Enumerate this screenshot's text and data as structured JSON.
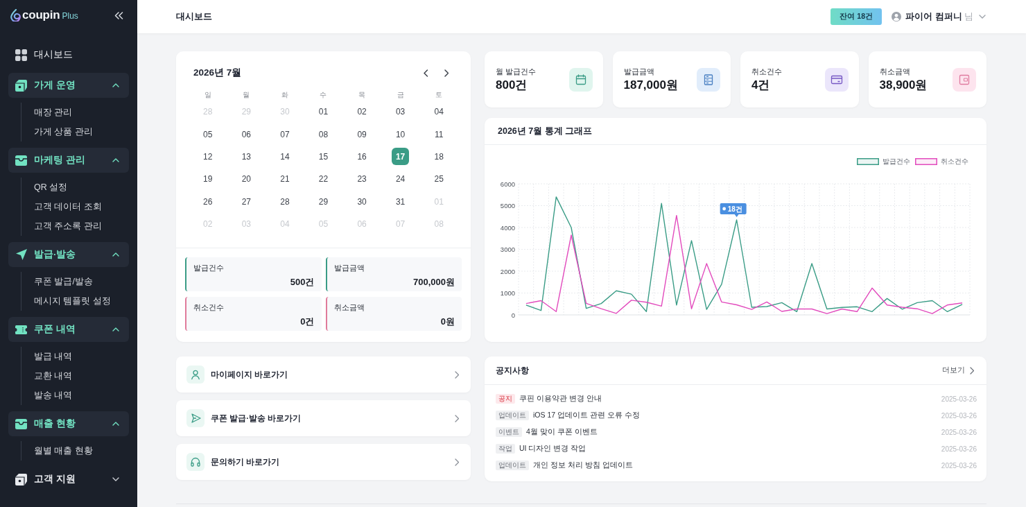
{
  "sidebar": {
    "logo": {
      "name": "coupin",
      "suffix": "Plus"
    },
    "items": [
      {
        "kind": "link",
        "label": "대시보드"
      },
      {
        "kind": "group",
        "label": "가게 운영",
        "expanded": true,
        "children": [
          {
            "label": "매장 관리"
          },
          {
            "label": "가게 상품 관리"
          }
        ]
      },
      {
        "kind": "group",
        "label": "마케팅 관리",
        "expanded": true,
        "children": [
          {
            "label": "QR 설정"
          },
          {
            "label": "고객 데이터 조회"
          },
          {
            "label": "고객 주소록 관리"
          }
        ]
      },
      {
        "kind": "group",
        "label": "발급·발송",
        "expanded": true,
        "children": [
          {
            "label": "쿠폰 발급/발송"
          },
          {
            "label": "메시지 템플릿 설정"
          }
        ]
      },
      {
        "kind": "group",
        "label": "쿠폰 내역",
        "expanded": true,
        "children": [
          {
            "label": "발급 내역"
          },
          {
            "label": "교환 내역"
          },
          {
            "label": "발송 내역"
          }
        ]
      },
      {
        "kind": "group",
        "label": "매출 현황",
        "expanded": true,
        "children": [
          {
            "label": "월별 매출 현황"
          }
        ]
      },
      {
        "kind": "group",
        "label": "고객 지원",
        "expanded": false
      }
    ]
  },
  "header": {
    "title": "대시보드",
    "badge": "잔여 18건",
    "user": {
      "name": "파이어 컴퍼니",
      "suffix": "님"
    }
  },
  "calendar": {
    "title": "2026년 7월",
    "weekdays": [
      "일",
      "월",
      "화",
      "수",
      "목",
      "금",
      "토"
    ],
    "weeks": [
      [
        {
          "day": "28",
          "outside": true,
          "selected": false
        },
        {
          "day": "29",
          "outside": true,
          "selected": false
        },
        {
          "day": "30",
          "outside": true,
          "selected": false
        },
        {
          "day": "01",
          "outside": false,
          "selected": false
        },
        {
          "day": "02",
          "outside": false,
          "selected": false
        },
        {
          "day": "03",
          "outside": false,
          "selected": false
        },
        {
          "day": "04",
          "outside": false,
          "selected": false
        }
      ],
      [
        {
          "day": "05",
          "outside": false,
          "selected": false
        },
        {
          "day": "06",
          "outside": false,
          "selected": false
        },
        {
          "day": "07",
          "outside": false,
          "selected": false
        },
        {
          "day": "08",
          "outside": false,
          "selected": false
        },
        {
          "day": "09",
          "outside": false,
          "selected": false
        },
        {
          "day": "10",
          "outside": false,
          "selected": false
        },
        {
          "day": "11",
          "outside": false,
          "selected": false
        }
      ],
      [
        {
          "day": "12",
          "outside": false,
          "selected": false
        },
        {
          "day": "13",
          "outside": false,
          "selected": false
        },
        {
          "day": "14",
          "outside": false,
          "selected": false
        },
        {
          "day": "15",
          "outside": false,
          "selected": false
        },
        {
          "day": "16",
          "outside": false,
          "selected": false
        },
        {
          "day": "17",
          "outside": false,
          "selected": true
        },
        {
          "day": "18",
          "outside": false,
          "selected": false
        }
      ],
      [
        {
          "day": "19",
          "outside": false,
          "selected": false
        },
        {
          "day": "20",
          "outside": false,
          "selected": false
        },
        {
          "day": "21",
          "outside": false,
          "selected": false
        },
        {
          "day": "22",
          "outside": false,
          "selected": false
        },
        {
          "day": "23",
          "outside": false,
          "selected": false
        },
        {
          "day": "24",
          "outside": false,
          "selected": false
        },
        {
          "day": "25",
          "outside": false,
          "selected": false
        }
      ],
      [
        {
          "day": "26",
          "outside": false,
          "selected": false
        },
        {
          "day": "27",
          "outside": false,
          "selected": false
        },
        {
          "day": "28",
          "outside": false,
          "selected": false
        },
        {
          "day": "29",
          "outside": false,
          "selected": false
        },
        {
          "day": "30",
          "outside": false,
          "selected": false
        },
        {
          "day": "31",
          "outside": false,
          "selected": false
        },
        {
          "day": "01",
          "outside": true,
          "selected": false
        }
      ],
      [
        {
          "day": "02",
          "outside": true,
          "selected": false
        },
        {
          "day": "03",
          "outside": true,
          "selected": false
        },
        {
          "day": "04",
          "outside": true,
          "selected": false
        },
        {
          "day": "05",
          "outside": true,
          "selected": false
        },
        {
          "day": "06",
          "outside": true,
          "selected": false
        },
        {
          "day": "07",
          "outside": true,
          "selected": false
        },
        {
          "day": "08",
          "outside": true,
          "selected": false
        }
      ]
    ],
    "summary": [
      {
        "kind": "issue",
        "label": "발급건수",
        "value": "500건"
      },
      {
        "kind": "issue",
        "label": "발급금액",
        "value": "700,000원"
      },
      {
        "kind": "cancel",
        "label": "취소건수",
        "value": "0건"
      },
      {
        "kind": "cancel",
        "label": "취소금액",
        "value": "0원"
      }
    ]
  },
  "quick_links": [
    {
      "kind": "mypage",
      "label": "마이페이지 바로가기"
    },
    {
      "kind": "send",
      "label": "쿠폰 발급·발송 바로가기"
    },
    {
      "kind": "support",
      "label": "문의하기 바로가기"
    }
  ],
  "stats": [
    {
      "kind": "issue-count",
      "label": "월 발급건수",
      "value": "800건"
    },
    {
      "kind": "issue-amount",
      "label": "발급금액",
      "value": "187,000원"
    },
    {
      "kind": "cancel-count",
      "label": "취소건수",
      "value": "4건"
    },
    {
      "kind": "cancel-amount",
      "label": "취소금액",
      "value": "38,900원"
    }
  ],
  "chart": {
    "chart_data": {
      "type": "line",
      "title": "2026년 7월 통계 그래프",
      "grid": true,
      "ylim": [
        0,
        6000
      ],
      "yticks": [
        0,
        1000,
        2000,
        3000,
        4000,
        5000,
        6000
      ],
      "series": [
        {
          "name": "발급건수",
          "color": "#3a9c86",
          "values": [
            450,
            200,
            5400,
            4000,
            300,
            520,
            1100,
            950,
            150,
            5100,
            450,
            3400,
            250,
            1400,
            4350,
            350,
            380,
            560,
            150,
            2350,
            270,
            340,
            370,
            150,
            750,
            260,
            560,
            650,
            150,
            480
          ]
        },
        {
          "name": "취소건수",
          "color": "#e24bbd",
          "values": [
            520,
            650,
            150,
            3650,
            530,
            280,
            70,
            670,
            580,
            400,
            4550,
            280,
            2350,
            590,
            460,
            250,
            590,
            160,
            270,
            270,
            60,
            270,
            150,
            1230,
            450,
            350,
            280,
            60,
            450,
            550
          ]
        }
      ],
      "annotations": [
        {
          "y": 4350,
          "text": "18건"
        }
      ]
    }
  },
  "notices": {
    "title": "공지사항",
    "more": "더보기",
    "items": [
      {
        "kind": "notice",
        "tag": "공지",
        "title": "쿠핀 이용약관 변경 안내",
        "date": "2025-03-26"
      },
      {
        "kind": "general",
        "tag": "업데이트",
        "title": "iOS 17 업데이트 관련 오류 수정",
        "date": "2025-03-26"
      },
      {
        "kind": "general",
        "tag": "이벤트",
        "title": "4월 맞이 쿠폰 이벤트",
        "date": "2025-03-26"
      },
      {
        "kind": "general",
        "tag": "작업",
        "title": "UI 디자인 변경 작업",
        "date": "2025-03-26"
      },
      {
        "kind": "general",
        "tag": "업데이트",
        "title": "개인 정보 처리 방침 업데이트",
        "date": "2025-03-26"
      }
    ]
  }
}
